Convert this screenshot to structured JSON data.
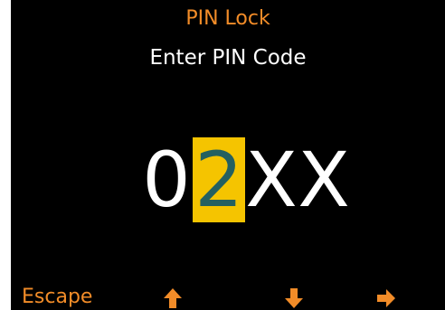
{
  "header": {
    "title": "PIN Lock",
    "subtitle": "Enter PIN Code"
  },
  "pin": {
    "digits": [
      "0",
      "2",
      "X",
      "X"
    ],
    "active_index": 1
  },
  "softkeys": {
    "escape_label": "Escape",
    "up_icon": "arrow-up-icon",
    "down_icon": "arrow-down-icon",
    "right_icon": "arrow-right-icon"
  },
  "colors": {
    "background": "#000000",
    "accent": "#f28c28",
    "text": "#ffffff",
    "highlight": "#f5c400",
    "active_digit": "#246060"
  }
}
